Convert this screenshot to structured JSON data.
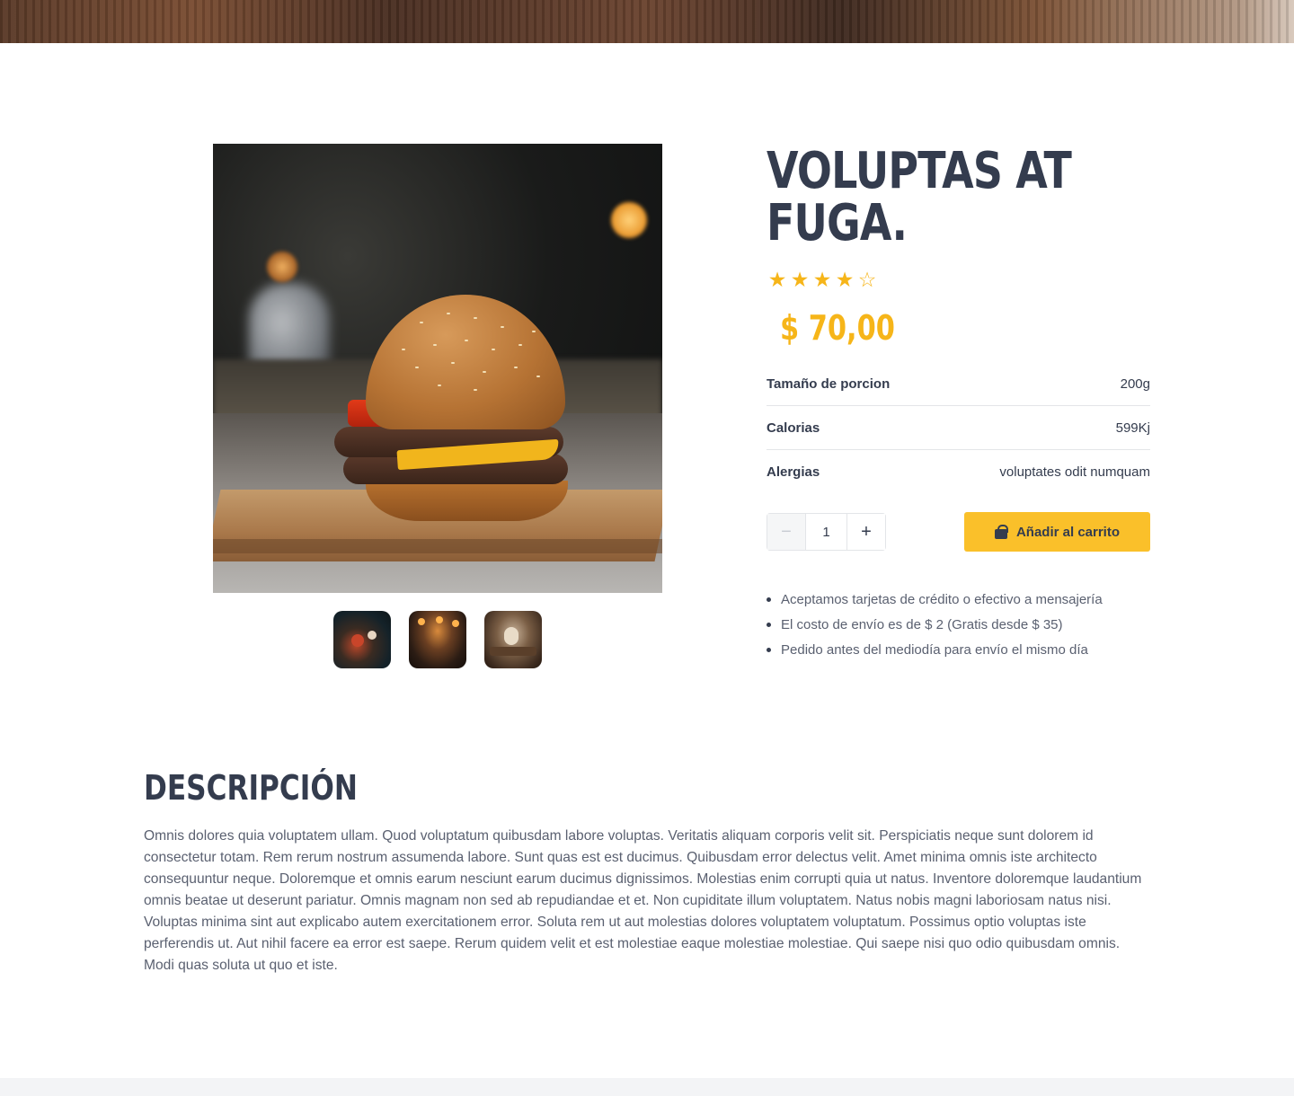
{
  "product": {
    "title": "VOLUPTAS AT FUGA.",
    "rating": 4,
    "rating_max": 5,
    "price": "$ 70,00",
    "specs": [
      {
        "label": "Tamaño de porcion",
        "value": "200g"
      },
      {
        "label": "Calorias",
        "value": "599Kj"
      },
      {
        "label": "Alergias",
        "value": "voluptates odit numquam"
      }
    ],
    "quantity": "1",
    "add_to_cart_label": "Añadir al carrito",
    "info": [
      "Aceptamos tarjetas de crédito o efectivo a mensajería",
      "El costo de envío es de $ 2 (Gratis desde $ 35)",
      "Pedido antes del mediodía para envío el mismo día"
    ]
  },
  "gallery": {
    "main_image_icon": "burger-photo",
    "thumbnails": [
      "restaurant-people-photo",
      "restaurant-interior-photo",
      "restaurant-dining-photo"
    ]
  },
  "description": {
    "heading": "DESCRIPCIÓN",
    "body": "Omnis dolores quia voluptatem ullam. Quod voluptatum quibusdam labore voluptas. Veritatis aliquam corporis velit sit. Perspiciatis neque sunt dolorem id consectetur totam. Rem rerum nostrum assumenda labore. Sunt quas est est ducimus. Quibusdam error delectus velit. Amet minima omnis iste architecto consequuntur neque. Doloremque et omnis earum nesciunt earum ducimus dignissimos. Molestias enim corrupti quia ut natus. Inventore doloremque laudantium omnis beatae ut deserunt pariatur. Omnis magnam non sed ab repudiandae et et. Non cupiditate illum voluptatem. Natus nobis magni laboriosam natus nisi. Voluptas minima sint aut explicabo autem exercitationem error. Soluta rem ut aut molestias dolores voluptatem voluptatum. Possimus optio voluptas iste perferendis ut. Aut nihil facere ea error est saepe. Rerum quidem velit et est molestiae eaque molestiae molestiae. Qui saepe nisi quo odio quibusdam omnis. Modi quas soluta ut quo et iste."
  },
  "colors": {
    "accent": "#fac02a",
    "star": "#f6b519",
    "heading": "#343c4e",
    "body_text": "#5a6070"
  },
  "icons": {
    "star_filled": "★",
    "star_empty": "☆",
    "minus": "−",
    "plus": "+",
    "cart": "shopping-bag-icon"
  }
}
